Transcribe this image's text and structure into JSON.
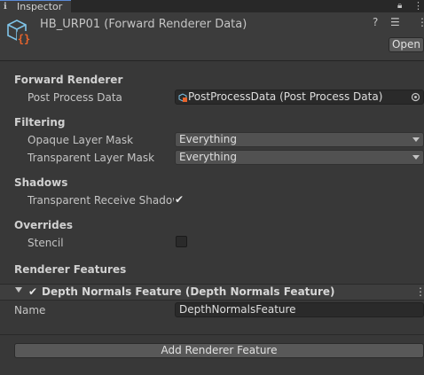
{
  "tab": {
    "label": "Inspector",
    "info_icon": "info-icon",
    "lock_icon": "lock-icon",
    "menu_icon": "kebab-menu-icon"
  },
  "header": {
    "title": "HB_URP01 (Forward Renderer Data)",
    "open_label": "Open",
    "asset_icon": "scriptable-object-icon",
    "help_icon": "help-icon",
    "settings_icon": "settings-icon",
    "menu_icon": "kebab-menu-icon"
  },
  "forward_renderer": {
    "heading": "Forward Renderer",
    "post_process_label": "Post Process Data",
    "post_process_value": "PostProcessData (Post Process Data)"
  },
  "filtering": {
    "heading": "Filtering",
    "opaque_label": "Opaque Layer Mask",
    "opaque_value": "Everything",
    "transparent_label": "Transparent Layer Mask",
    "transparent_value": "Everything"
  },
  "shadows": {
    "heading": "Shadows",
    "receive_label": "Transparent Receive Shadows",
    "receive_checked": true
  },
  "overrides": {
    "heading": "Overrides",
    "stencil_label": "Stencil",
    "stencil_checked": false
  },
  "renderer_features": {
    "heading": "Renderer Features",
    "feature_title": "Depth Normals Feature (Depth Normals Feature)",
    "feature_enabled": true,
    "name_label": "Name",
    "name_value": "DepthNormalsFeature",
    "add_label": "Add Renderer Feature"
  },
  "colors": {
    "background": "#383838",
    "field": "#2a2a2a",
    "button": "#585858",
    "accent": "#5a8ad6"
  }
}
